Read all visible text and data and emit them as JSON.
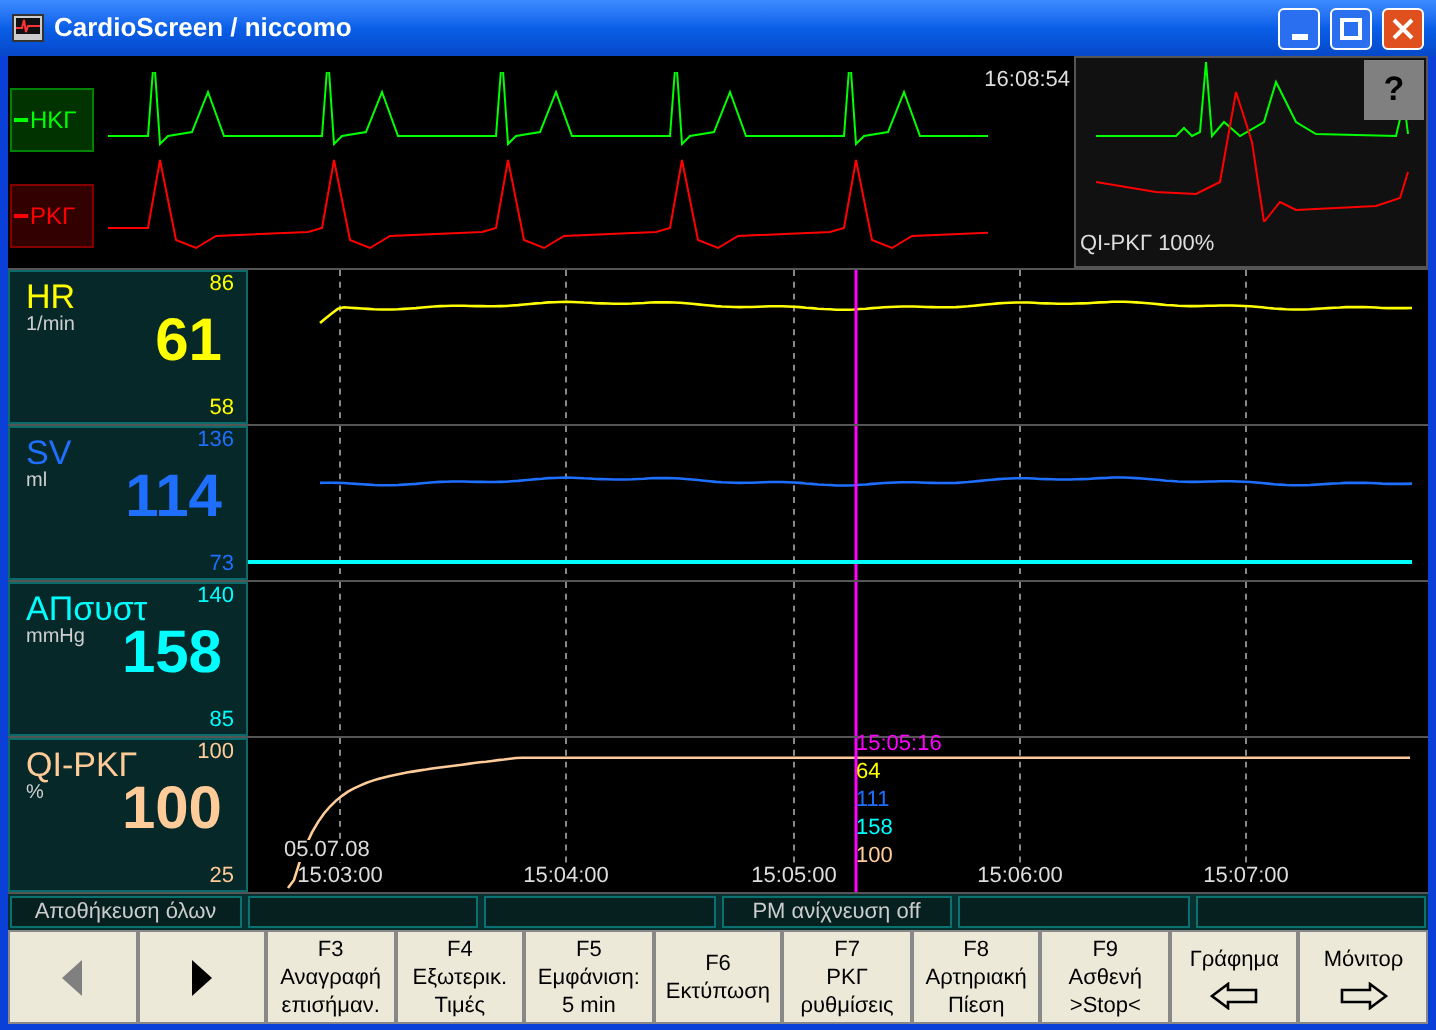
{
  "window": {
    "title": "CardioScreen / niccomo"
  },
  "ecg": {
    "time": "16:08:54",
    "leads": [
      {
        "label": "ΗΚΓ",
        "color": "#00ff00"
      },
      {
        "label": "ΡΚΓ",
        "color": "#ff0000"
      }
    ],
    "inset": {
      "help": "?",
      "caption": "QI-ΡΚΓ 100%"
    }
  },
  "parameters": [
    {
      "label": "HR",
      "unit": "1/min",
      "value": "61",
      "scale_max": "86",
      "scale_min": "58",
      "color": "#ffff00",
      "kind": "wave"
    },
    {
      "label": "SV",
      "unit": "ml",
      "value": "114",
      "scale_max": "136",
      "scale_min": "73",
      "color": "#1f6fff",
      "kind": "wave",
      "reference_line": true
    },
    {
      "label": "ΑΠσυστ",
      "unit": "mmHg",
      "value": "158",
      "scale_max": "140",
      "scale_min": "85",
      "color": "#00ffff",
      "kind": "blank"
    },
    {
      "label": "QI-ΡΚΓ",
      "unit": "%",
      "value": "100",
      "scale_max": "100",
      "scale_min": "25",
      "color": "#ffcc99",
      "kind": "rise"
    }
  ],
  "time_axis": {
    "date": "05.07.08",
    "ticks": [
      "15:03:00",
      "15:04:00",
      "15:05:00",
      "15:06:00",
      "15:07:00"
    ]
  },
  "cursor": {
    "time": "15:05:16",
    "readings": [
      "64",
      "111",
      "158",
      "100"
    ]
  },
  "status_bar": [
    {
      "kind": "text",
      "text": "Αποθήκευση όλων"
    },
    {
      "kind": "empty"
    },
    {
      "kind": "empty"
    },
    {
      "kind": "text",
      "text": "PM ανίχνευση off"
    },
    {
      "kind": "empty"
    },
    {
      "kind": "empty"
    }
  ],
  "buttons": [
    {
      "kind": "previous",
      "disabled": true
    },
    {
      "kind": "next",
      "disabled": false
    },
    {
      "kind": "fkey",
      "key": "F3",
      "lines": [
        "Αναγραφή",
        "επισήμαν."
      ]
    },
    {
      "kind": "fkey",
      "key": "F4",
      "lines": [
        "Εξωτερικ.",
        "Τιμές"
      ]
    },
    {
      "kind": "fkey",
      "key": "F5",
      "lines": [
        "Εμφάνιση:",
        "5 min"
      ]
    },
    {
      "kind": "fkey",
      "key": "F6",
      "lines": [
        "Εκτύπωση"
      ]
    },
    {
      "kind": "fkey",
      "key": "F7",
      "lines": [
        "ΡΚΓ",
        "ρυθμίσεις"
      ]
    },
    {
      "kind": "fkey",
      "key": "F8",
      "lines": [
        "Αρτηριακή",
        "Πίεση"
      ]
    },
    {
      "kind": "fkey",
      "key": "F9",
      "lines": [
        "Ασθενή",
        ">Stop<"
      ]
    },
    {
      "kind": "backview",
      "label": "Γράφημα"
    },
    {
      "kind": "forwardview",
      "label": "Μόνιτορ"
    }
  ]
}
